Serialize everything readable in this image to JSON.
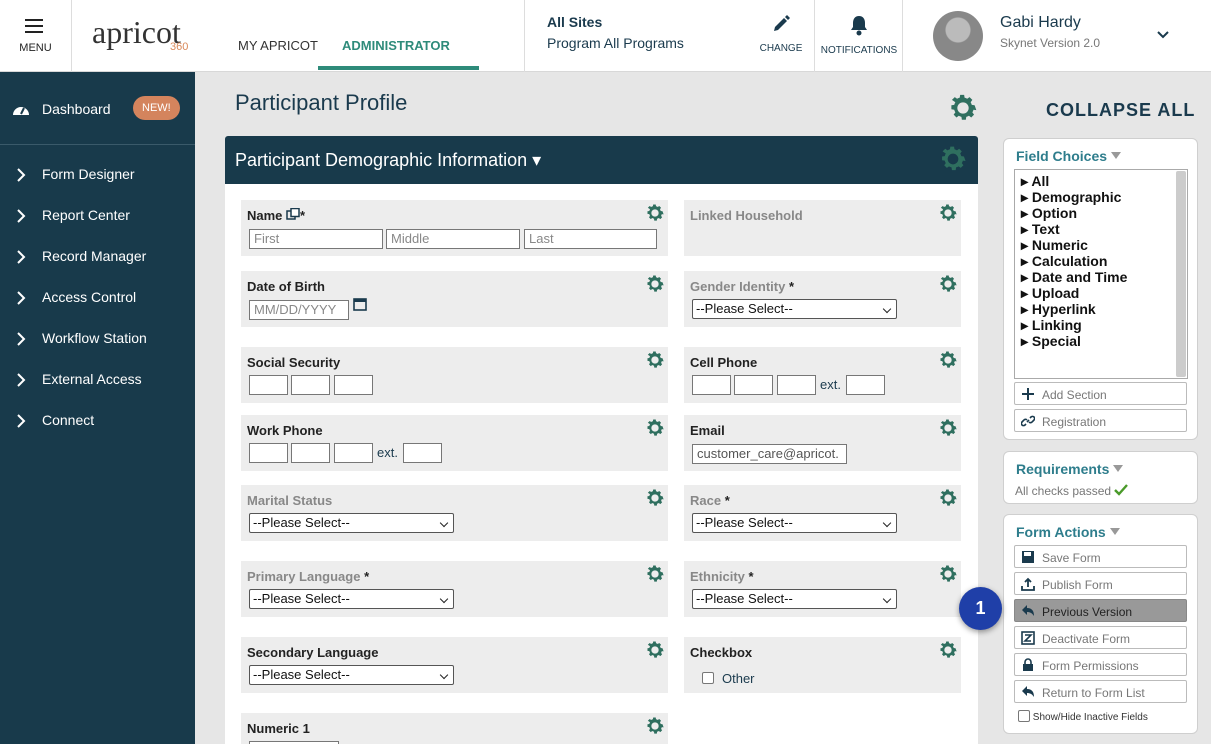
{
  "topbar": {
    "menu_label": "MENU",
    "logo_text": "apricot",
    "logo_suffix": "360",
    "tabs": [
      {
        "label": "MY APRICOT"
      },
      {
        "label": "ADMINISTRATOR"
      }
    ],
    "sites_label": "All Sites",
    "programs_label": "Program All Programs",
    "change_label": "CHANGE",
    "notifications_label": "NOTIFICATIONS",
    "user_name": "Gabi Hardy",
    "user_version": "Skynet Version 2.0"
  },
  "sidebar": {
    "dashboard_label": "Dashboard",
    "new_badge": "NEW!",
    "items": [
      {
        "label": "Form Designer"
      },
      {
        "label": "Report Center"
      },
      {
        "label": "Record Manager"
      },
      {
        "label": "Access Control"
      },
      {
        "label": "Workflow Station"
      },
      {
        "label": "External Access"
      },
      {
        "label": "Connect"
      }
    ]
  },
  "main": {
    "page_title": "Participant Profile",
    "collapse_all": "COLLAPSE ALL",
    "section_title": "Participant Demographic Information ▾",
    "fields": {
      "name": {
        "label": "Name",
        "first_placeholder": "First",
        "middle_placeholder": "Middle",
        "last_placeholder": "Last"
      },
      "linked_household": {
        "label": "Linked Household"
      },
      "dob": {
        "label": "Date of Birth",
        "placeholder": "MM/DD/YYYY"
      },
      "gender": {
        "label": "Gender Identity",
        "value": "--Please Select--"
      },
      "ssn": {
        "label": "Social Security"
      },
      "cell_phone": {
        "label": "Cell Phone",
        "ext": "ext."
      },
      "work_phone": {
        "label": "Work Phone",
        "ext": "ext."
      },
      "email": {
        "label": "Email",
        "value": "customer_care@apricot."
      },
      "marital": {
        "label": "Marital Status",
        "value": "--Please Select--"
      },
      "race": {
        "label": "Race",
        "value": "--Please Select--"
      },
      "primary_language": {
        "label": "Primary Language",
        "value": "--Please Select--"
      },
      "ethnicity": {
        "label": "Ethnicity",
        "value": "--Please Select--"
      },
      "secondary_language": {
        "label": "Secondary Language",
        "value": "--Please Select--"
      },
      "checkbox": {
        "label": "Checkbox",
        "option": "Other"
      },
      "numeric1": {
        "label": "Numeric 1"
      },
      "required_mark": "*"
    }
  },
  "right": {
    "field_choices": {
      "title": "Field Choices",
      "items": [
        "▸ All",
        "▸ Demographic",
        "▸ Option",
        "▸ Text",
        "▸ Numeric",
        "▸ Calculation",
        "▸ Date and Time",
        "▸ Upload",
        "▸ Hyperlink",
        "▸ Linking",
        "▸ Special"
      ],
      "add_section": "Add Section",
      "registration": "Registration"
    },
    "requirements": {
      "title": "Requirements",
      "status": "All checks passed"
    },
    "form_actions": {
      "title": "Form Actions",
      "save": "Save Form",
      "publish": "Publish Form",
      "previous": "Previous Version",
      "deactivate": "Deactivate Form",
      "permissions": "Form Permissions",
      "return": "Return to Form List",
      "show_hide": "Show/Hide Inactive Fields"
    },
    "step_badge": "1"
  },
  "colors": {
    "navy": "#183a4b",
    "teal": "#2e8b7a",
    "accent_orange": "#d4845d",
    "badge_blue": "#1f3fa8"
  }
}
